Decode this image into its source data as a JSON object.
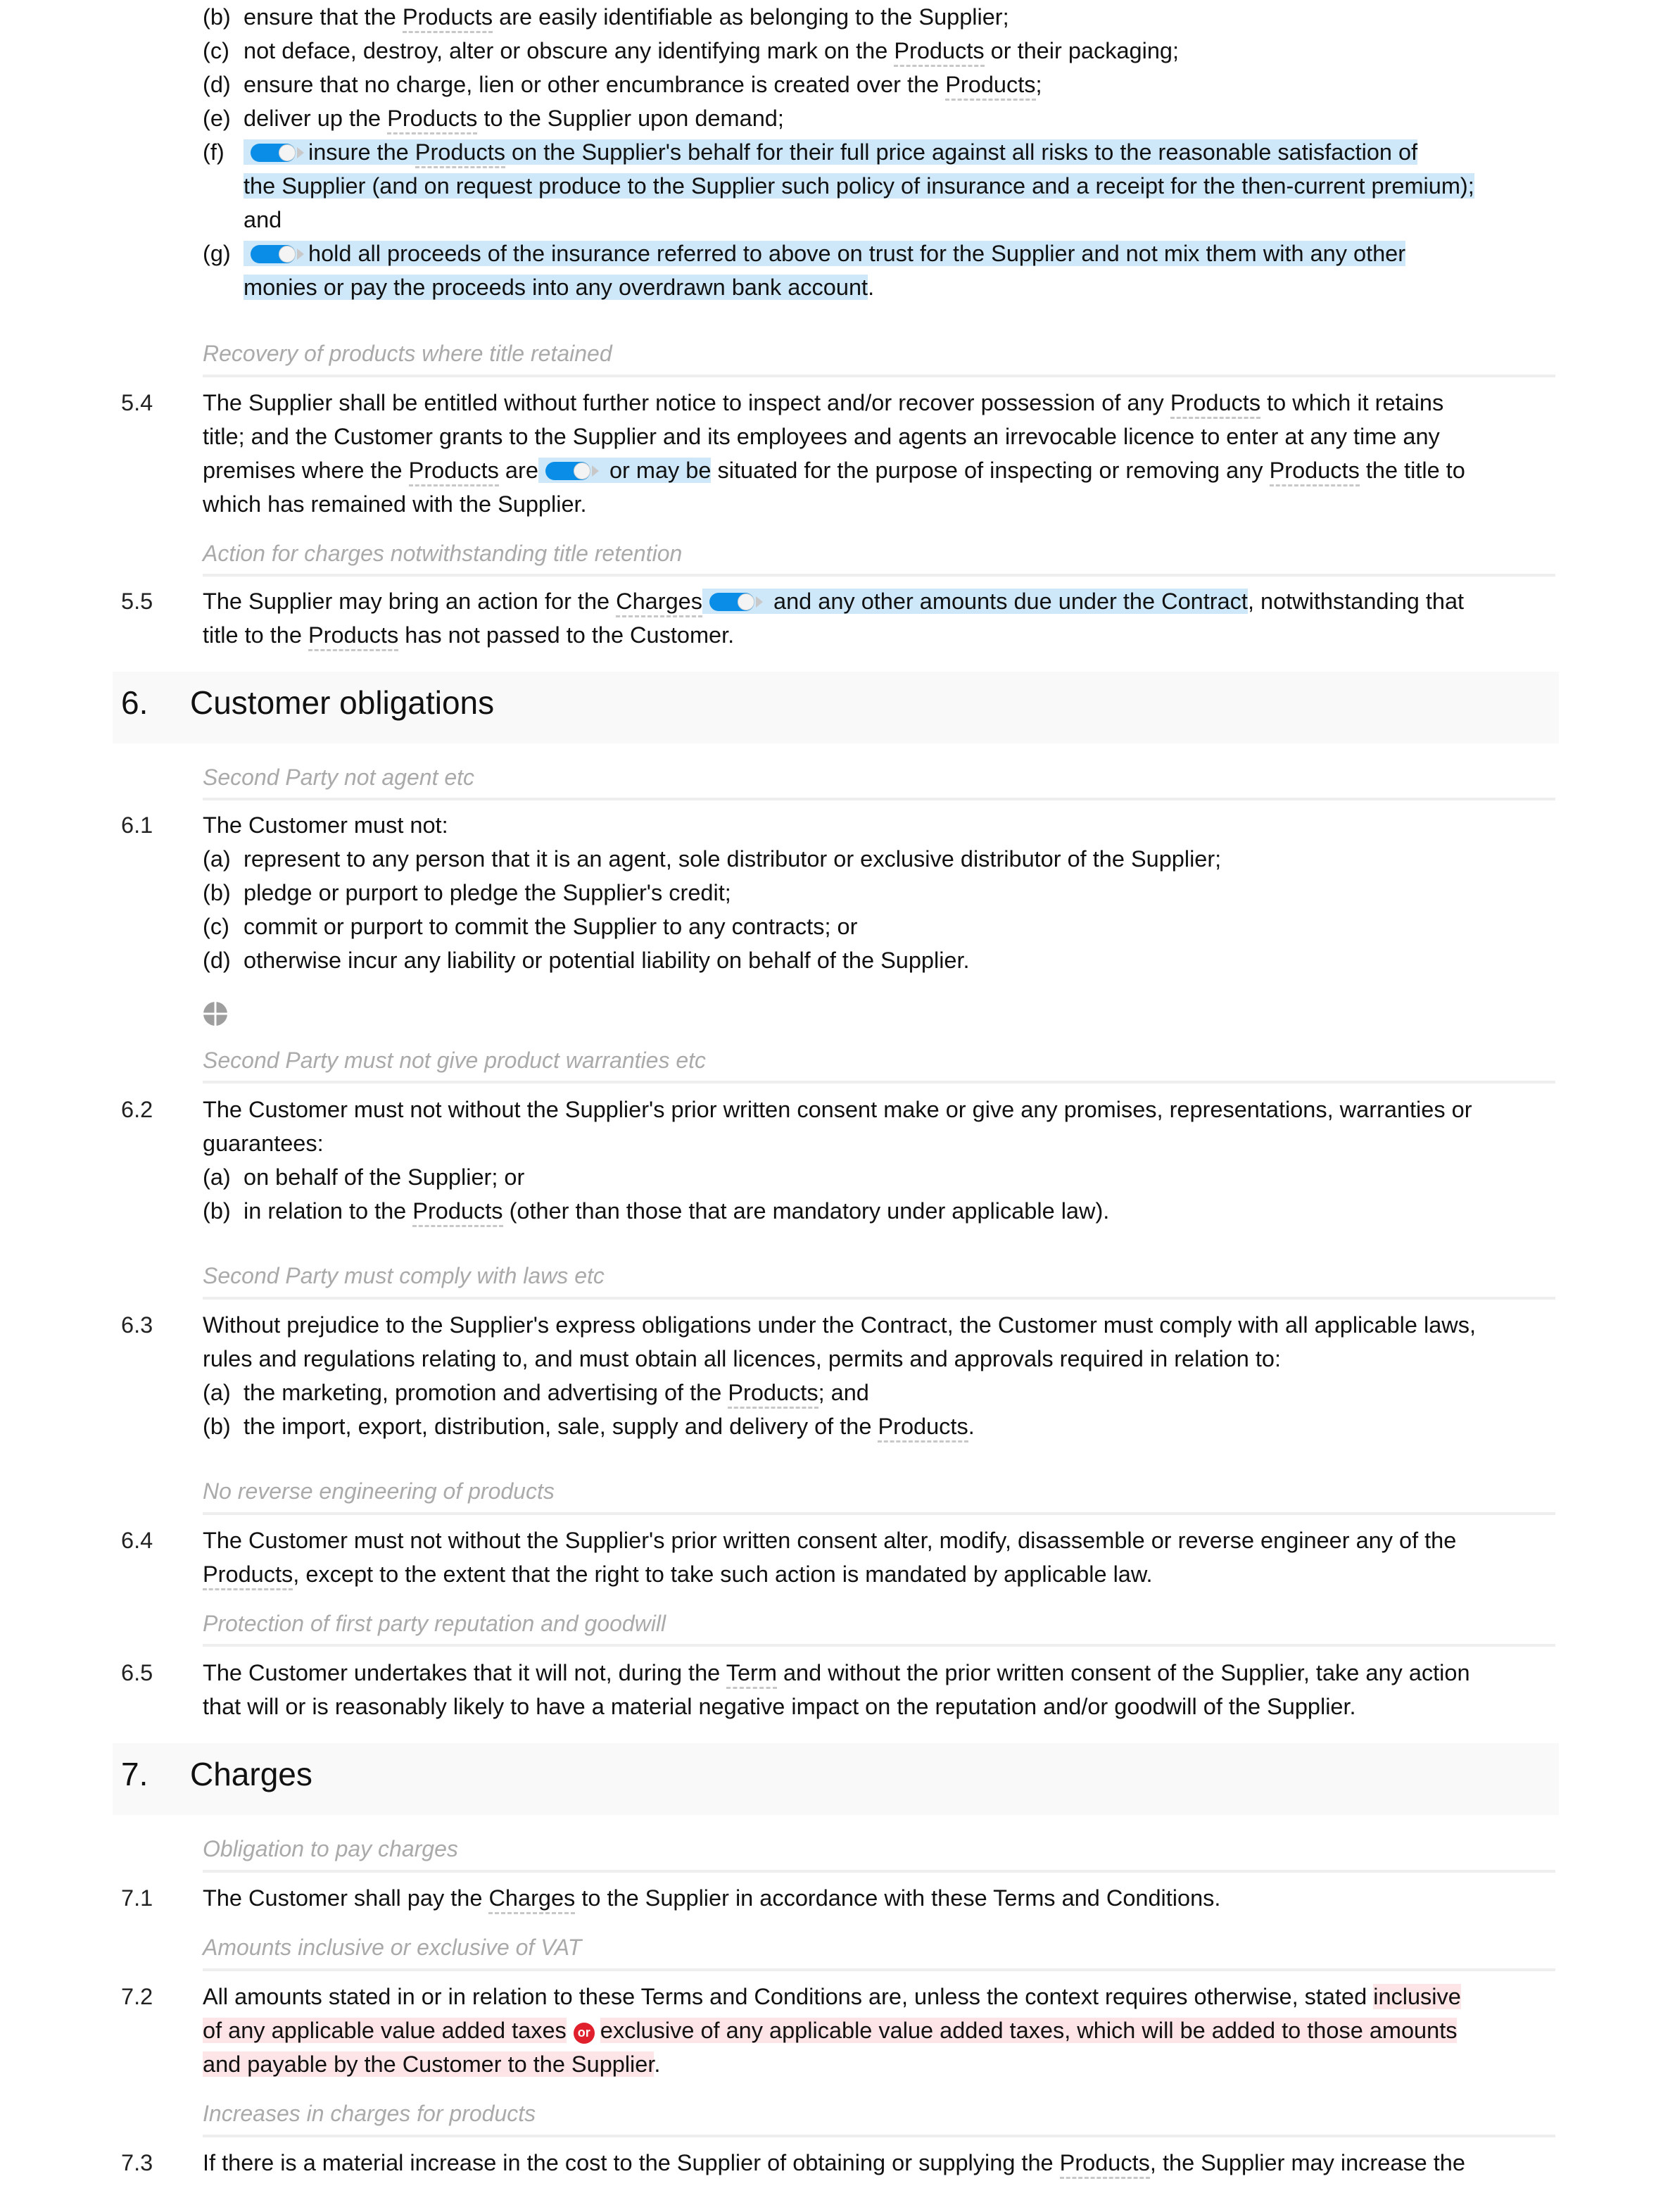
{
  "defined_term_products": "Products",
  "defined_term_charges": "Charges",
  "defined_term_term": "Term",
  "colors": {
    "toggle_on": "#0a8de6",
    "optional_highlight": "#cfe8f9",
    "alternative_highlight": "#fde4e6",
    "or_badge": "#e0212d",
    "heading_bg": "#f9f9f9",
    "subheading_text": "#aaaaaa"
  },
  "clause_5_3_items": {
    "b": {
      "label": "(b)",
      "pre": "ensure that the ",
      "post": " are easily identifiable as belonging to the Supplier;"
    },
    "c": {
      "label": "(c)",
      "pre": "not deface, destroy, alter or obscure any identifying mark on the ",
      "post": " or their packaging;"
    },
    "d": {
      "label": "(d)",
      "pre": "ensure that no charge, lien or other encumbrance is created over the ",
      "post": ";"
    },
    "e": {
      "label": "(e)",
      "pre": "deliver up the ",
      "post": " to the Supplier upon demand;"
    },
    "f": {
      "label": "(f)",
      "line1_pre": "insure the ",
      "line1_post": " on the Supplier's behalf for their full price against all risks to the reasonable satisfaction of",
      "line2": "the Supplier (and on request produce to the Supplier such policy of insurance and a receipt for the then-current premium);",
      "line3": "and",
      "toggle_state": "on"
    },
    "g": {
      "label": "(g)",
      "line1": "hold all proceeds of the insurance referred to above on trust for the Supplier and not mix them with any other",
      "line2": "monies or pay the proceeds into any overdrawn bank account",
      "line2_end": ".",
      "toggle_state": "on"
    }
  },
  "section5": {
    "c54": {
      "subheading": "Recovery of products where title retained",
      "number": "5.4",
      "l1_pre": "The Supplier shall be entitled without further notice to inspect and/or recover possession of any ",
      "l1_post": " to which it retains",
      "l2": "title; and the Customer grants to the Supplier and its employees and agents an irrevocable licence to enter at any time any",
      "l3_pre": "premises where the ",
      "l3_mid": " are",
      "l3_opt": " or may be",
      "l3_post1": " situated for the purpose of inspecting or removing any ",
      "l3_post2": " the title to",
      "l4": "which has remained with the Supplier.",
      "toggle_state": "on"
    },
    "c55": {
      "subheading": "Action for charges notwithstanding title retention",
      "number": "5.5",
      "l1_pre": "The Supplier may bring an action for the ",
      "l1_opt": " and any other amounts due under the Contract",
      "l1_post": ", notwithstanding that",
      "l2_pre": "title to the ",
      "l2_post": " has not passed to the Customer.",
      "toggle_state": "on"
    }
  },
  "section6": {
    "number": "6.",
    "title": "Customer obligations",
    "c61": {
      "subheading": "Second Party not agent etc",
      "number": "6.1",
      "intro": "The Customer must not:",
      "items": [
        {
          "label": "(a)",
          "text": "represent to any person that it is an agent, sole distributor or exclusive distributor of the Supplier;"
        },
        {
          "label": "(b)",
          "text": "pledge or purport to pledge the Supplier's credit;"
        },
        {
          "label": "(c)",
          "text": "commit or purport to commit the Supplier to any contracts; or"
        },
        {
          "label": "(d)",
          "text": "otherwise incur any liability or potential liability on behalf of the Supplier."
        }
      ]
    },
    "drag_handle_icon": "move-handle-icon",
    "c62": {
      "subheading": "Second Party must not give product warranties etc",
      "number": "6.2",
      "l1": "The Customer must not without the Supplier's prior written consent make or give any promises, representations, warranties or",
      "l2": "guarantees:",
      "a_label": "(a)",
      "a_text": "on behalf of the Supplier; or",
      "b_label": "(b)",
      "b_pre": "in relation to the ",
      "b_post": " (other than those that are mandatory under applicable law)."
    },
    "c63": {
      "subheading": "Second Party must comply with laws etc",
      "number": "6.3",
      "l1": "Without prejudice to the Supplier's express obligations under the Contract, the Customer must comply with all applicable laws,",
      "l2": "rules and regulations relating to, and must obtain all licences, permits and approvals required in relation to:",
      "a_label": "(a)",
      "a_pre": "the marketing, promotion and advertising of the ",
      "a_post": "; and",
      "b_label": "(b)",
      "b_pre": "the import, export, distribution, sale, supply and delivery of the ",
      "b_post": "."
    },
    "c64": {
      "subheading": "No reverse engineering of products",
      "number": "6.4",
      "l1": "The Customer must not without the Supplier's prior written consent alter, modify, disassemble or reverse engineer any of the",
      "l2_post": ", except to the extent that the right to take such action is mandated by applicable law."
    },
    "c65": {
      "subheading": "Protection of first party reputation and goodwill",
      "number": "6.5",
      "l1_pre": "The Customer undertakes that it will not, during the ",
      "l1_post": " and without the prior written consent of the Supplier, take any action",
      "l2": "that will or is reasonably likely to have a material negative impact on the reputation and/or goodwill of the Supplier."
    }
  },
  "section7": {
    "number": "7.",
    "title": "Charges",
    "c71": {
      "subheading": "Obligation to pay charges",
      "number": "7.1",
      "pre": "The Customer shall pay the ",
      "post": " to the Supplier in accordance with these Terms and Conditions."
    },
    "c72": {
      "subheading": "Amounts inclusive or exclusive of VAT",
      "number": "7.2",
      "l1_pre": "All amounts stated in or in relation to these Terms and Conditions are, unless the context requires otherwise, stated ",
      "l1_alt": "inclusive",
      "l2_alt1": "of any applicable value added taxes",
      "or_label": "or",
      "l2_alt2": "exclusive of any applicable value added taxes, which will be added to those amounts",
      "l3_alt2": "and payable by the Customer to the Supplier",
      "l3_end": "."
    },
    "c73": {
      "subheading": "Increases in charges for products",
      "number": "7.3",
      "l1_pre": "If there is a material increase in the cost to the Supplier of obtaining or supplying the ",
      "l1_post": ", the Supplier may increase the"
    }
  }
}
